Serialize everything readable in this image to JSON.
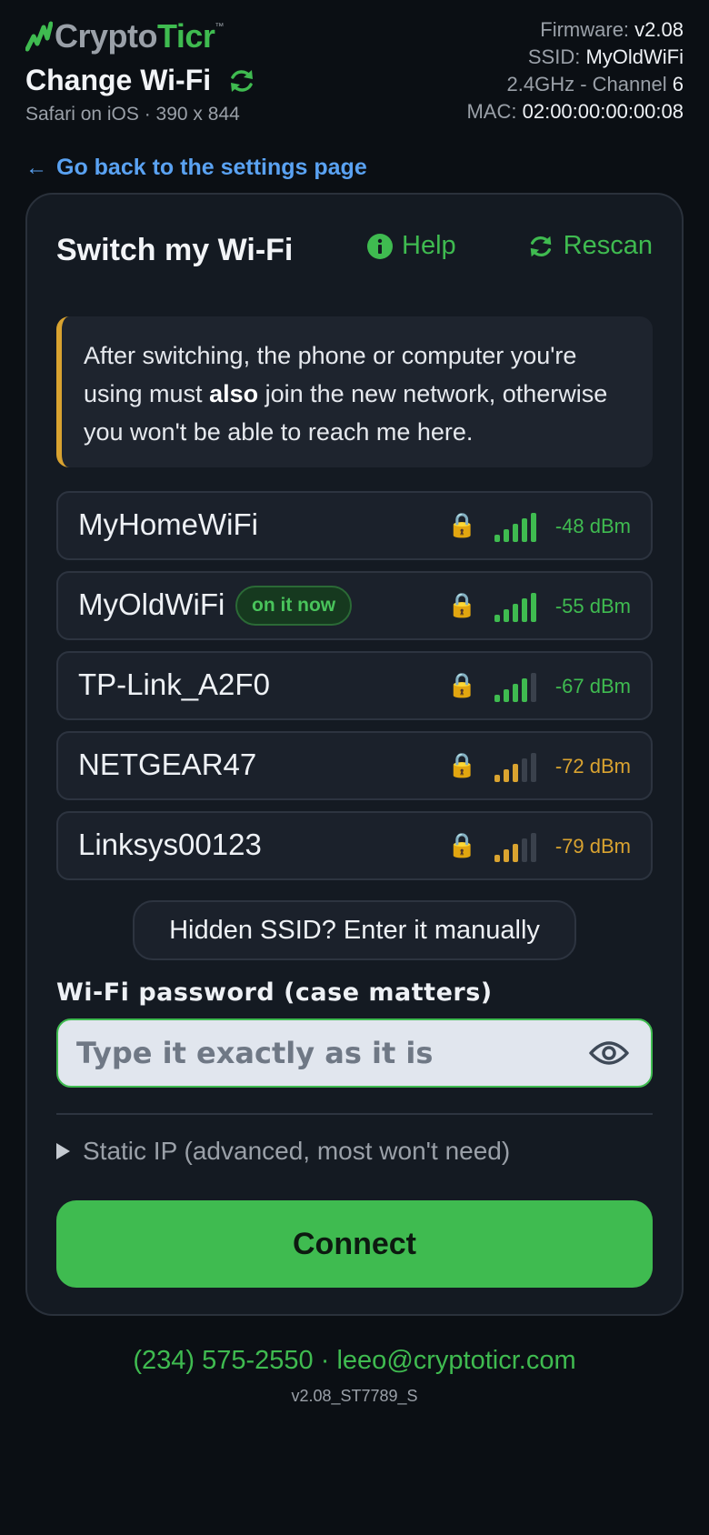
{
  "brand": {
    "part1": "Crypto",
    "part2": "Ticr",
    "tm": "™"
  },
  "header": {
    "title": "Change Wi-Fi",
    "subtitle": "Safari on iOS · 390 x 844",
    "device": [
      {
        "label": "Firmware:",
        "value": "v2.08"
      },
      {
        "label": "SSID:",
        "value": "MyOldWiFi"
      },
      {
        "label": "2.4GHz - Channel",
        "value": "6"
      },
      {
        "label": "MAC:",
        "value": "02:00:00:00:00:08"
      }
    ]
  },
  "back_link": {
    "arrow": "←",
    "label": "Go back to the settings page"
  },
  "card": {
    "title": "Switch my Wi-Fi",
    "help_label": "Help",
    "rescan_label": "Rescan",
    "notice": {
      "before": "After switching, the phone or computer you're using must ",
      "emphasis": "also",
      "after": " join the new network, otherwise you won't be able to reach me here."
    },
    "networks": [
      {
        "ssid": "MyHomeWiFi",
        "badge": "",
        "locked": true,
        "bars": 5,
        "signal": "-48 dBm",
        "color": "#3fbb50"
      },
      {
        "ssid": "MyOldWiFi",
        "badge": "on it now",
        "locked": true,
        "bars": 5,
        "signal": "-55 dBm",
        "color": "#3fbb50"
      },
      {
        "ssid": "TP-Link_A2F0",
        "badge": "",
        "locked": true,
        "bars": 4,
        "signal": "-67 dBm",
        "color": "#3fbb50"
      },
      {
        "ssid": "NETGEAR47",
        "badge": "",
        "locked": true,
        "bars": 3,
        "signal": "-72 dBm",
        "color": "#d9a330"
      },
      {
        "ssid": "Linksys00123",
        "badge": "",
        "locked": true,
        "bars": 3,
        "signal": "-79 dBm",
        "color": "#d9a330"
      }
    ],
    "manual_button": "Hidden SSID? Enter it manually",
    "password_label": "Wi-Fi password (case matters)",
    "password_placeholder": "Type it exactly as it is",
    "password_value": "",
    "static_ip_label": "Static IP (advanced, most won't need)",
    "connect_label": "Connect"
  },
  "footer": {
    "phone": "(234) 575-2550",
    "separator": " · ",
    "email": "leeo@cryptoticr.com",
    "version": "v2.08_ST7789_S"
  },
  "colors": {
    "accent_green": "#3fbb50",
    "warning_amber": "#d9a330",
    "link_blue": "#5aa2f2",
    "background": "#0b0f14"
  },
  "icons": {
    "logo": "cryptoticr-logo-icon",
    "refresh": "refresh-icon",
    "help": "info-icon",
    "rescan": "refresh-icon",
    "lock": "lock-icon",
    "signal": "signal-bars-icon",
    "eye": "eye-icon",
    "disclosure": "triangle-right-icon"
  }
}
